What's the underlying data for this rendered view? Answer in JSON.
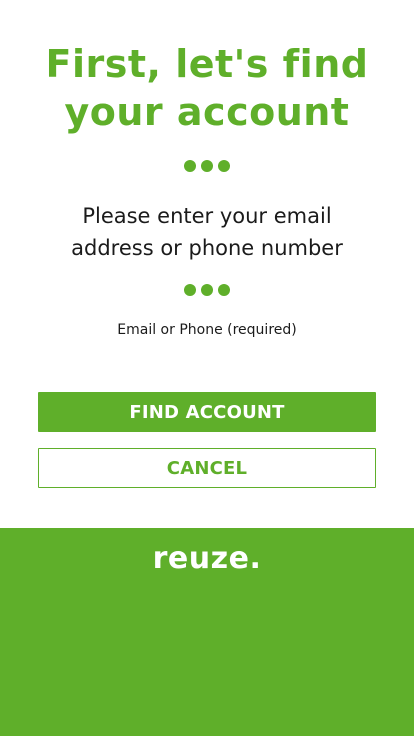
{
  "header": {
    "title_line1": "First, let's find",
    "title_line2": "your account"
  },
  "instructions": {
    "line1": "Please enter your email",
    "line2": "address or phone number"
  },
  "form": {
    "field_label": "Email or Phone (required)",
    "field_value": "",
    "field_placeholder": ""
  },
  "actions": {
    "find_label": "FIND ACCOUNT",
    "cancel_label": "CANCEL"
  },
  "footer": {
    "logo_text": "reuze."
  },
  "colors": {
    "brand_green": "#5faf2a",
    "text_dark": "#1b1b1b",
    "background": "#ffffff"
  },
  "icons": {
    "separator": "three-dots-separator"
  }
}
